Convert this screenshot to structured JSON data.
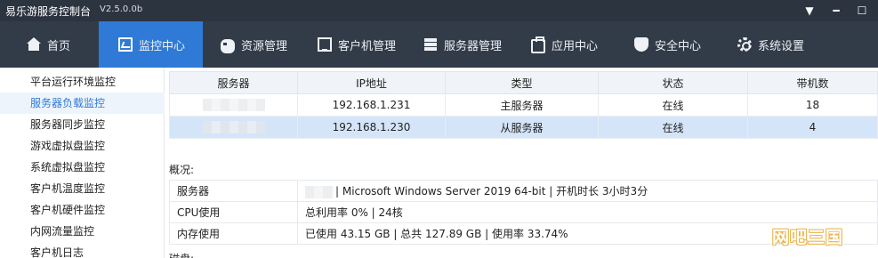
{
  "app": {
    "title": "易乐游服务控制台",
    "version": "V2.5.0.0b",
    "window_controls": [
      "dropdown-icon",
      "minimize-icon",
      "maximize-icon"
    ]
  },
  "nav": {
    "items": [
      {
        "label": "首页",
        "icon": "home-icon"
      },
      {
        "label": "监控中心",
        "icon": "monitor-icon",
        "active": true
      },
      {
        "label": "资源管理",
        "icon": "gamepad-icon"
      },
      {
        "label": "客户机管理",
        "icon": "screen-icon"
      },
      {
        "label": "服务器管理",
        "icon": "server-icon"
      },
      {
        "label": "应用中心",
        "icon": "bag-icon"
      },
      {
        "label": "安全中心",
        "icon": "shield-icon"
      },
      {
        "label": "系统设置",
        "icon": "gear-icon"
      }
    ]
  },
  "sidebar": {
    "items": [
      {
        "label": "平台运行环境监控"
      },
      {
        "label": "服务器负载监控",
        "active": true
      },
      {
        "label": "服务器同步监控"
      },
      {
        "label": "游戏虚拟盘监控"
      },
      {
        "label": "系统虚拟盘监控"
      },
      {
        "label": "客户机温度监控"
      },
      {
        "label": "客户机硬件监控"
      },
      {
        "label": "内网流量监控"
      },
      {
        "label": "客户机日志"
      }
    ]
  },
  "servers": {
    "columns": [
      "服务器",
      "IP地址",
      "类型",
      "状态",
      "带机数"
    ],
    "rows": [
      {
        "ip": "192.168.1.231",
        "type": "主服务器",
        "status": "在线",
        "count": "18"
      },
      {
        "ip": "192.168.1.230",
        "type": "从服务器",
        "status": "在线",
        "count": "4",
        "selected": true
      }
    ]
  },
  "overview": {
    "label": "概况:",
    "rows": [
      {
        "key": "服务器",
        "value": "| Microsoft Windows Server 2019 64-bit | 开机时长 3小时3分"
      },
      {
        "key": "CPU使用",
        "value": "总利用率 0% | 24核"
      },
      {
        "key": "内存使用",
        "value": "已使用 43.15  GB | 总共 127.89  GB | 使用率 33.74%"
      }
    ]
  },
  "next_section_label": "磁盘:",
  "watermark": "网吧三国",
  "colors": {
    "titlebar": "#2c3440",
    "navbar": "#323b48",
    "accent": "#2f7ad6",
    "selected_row": "#d5e5f9",
    "watermark": "#e9b44c"
  }
}
